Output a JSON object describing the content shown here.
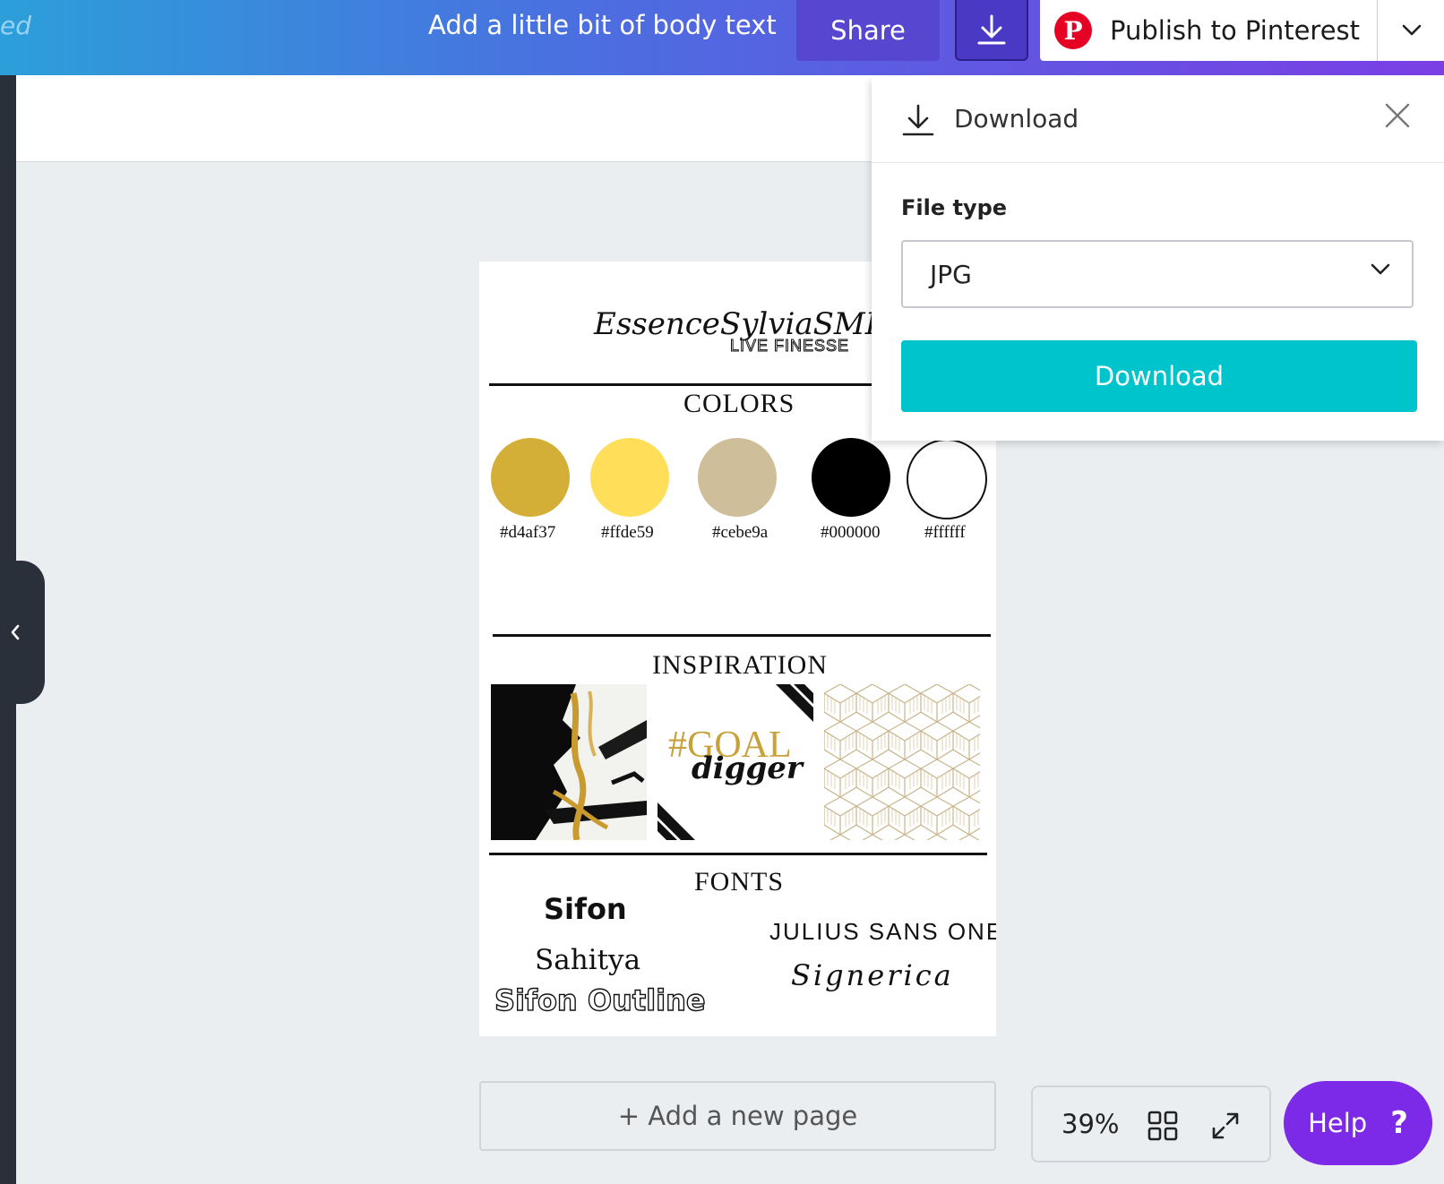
{
  "topbar": {
    "saved_fragment": "ed",
    "title": "Add a little bit of body text",
    "share_label": "Share",
    "download_icon": "download-icon",
    "publish_label": "Publish to Pinterest",
    "pinterest_icon": "pinterest-icon",
    "gradient_start": "#2c9fd9",
    "gradient_end": "#7b3fe4"
  },
  "canvas": {
    "logo": {
      "script_text": "EssenceSylviaSMITH",
      "tagline": "LIVE FINESSE"
    },
    "colors_title": "COLORS",
    "swatches": [
      {
        "color": "#d4af37",
        "label": "#d4af37"
      },
      {
        "color": "#ffde59",
        "label": "#ffde59"
      },
      {
        "color": "#cebe9a",
        "label": "#cebe9a"
      },
      {
        "color": "#000000",
        "label": "#000000"
      },
      {
        "color": "#ffffff",
        "label": "#ffffff"
      }
    ],
    "inspiration_title": "INSPIRATION",
    "inspiration": {
      "goal_text": "#GOAL",
      "digger_text": "digger"
    },
    "fonts_title": "FONTS",
    "fonts": {
      "sifon": "Sifon",
      "sahitya": "Sahitya",
      "sifon_outline": "Sifon Outline",
      "julius": "JULIUS SANS ONE",
      "signerica": "Signerica"
    }
  },
  "download_panel": {
    "title": "Download",
    "file_type_label": "File type",
    "file_type_value": "JPG",
    "submit_label": "Download",
    "accent": "#00c4cc"
  },
  "bottom": {
    "add_page_label": "+ Add a new page",
    "zoom": "39%",
    "help_label": "Help",
    "help_symbol": "?",
    "help_color": "#7d2ae8"
  }
}
